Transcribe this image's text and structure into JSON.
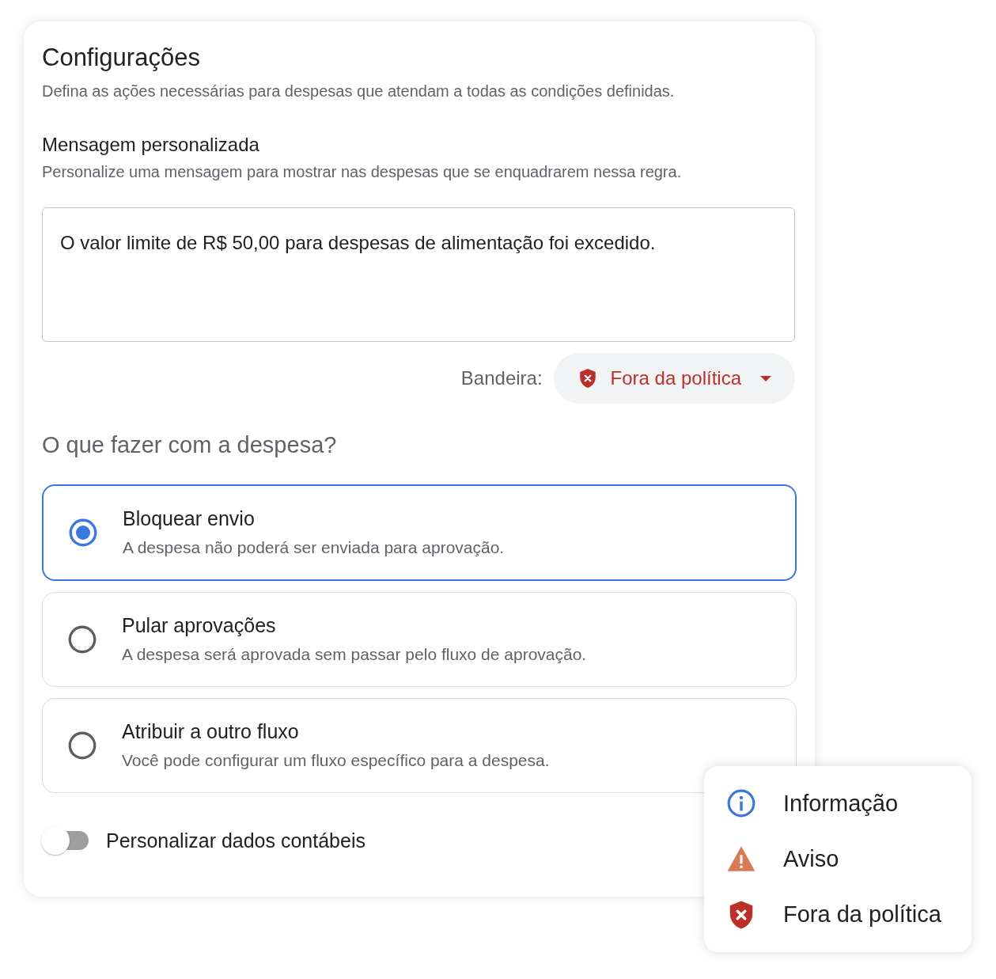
{
  "settings": {
    "title": "Configurações",
    "description": "Defina as ações necessárias para despesas que atendam a todas as condições definidas.",
    "custom_message": {
      "heading": "Mensagem personalizada",
      "description": "Personalize uma mensagem para mostrar nas despesas que se enquadrarem nessa regra.",
      "value": "O valor limite de R$ 50,00 para despesas de alimentação foi excedido."
    },
    "flag": {
      "label": "Bandeira:",
      "value": "Fora da política",
      "kind": "out_of_policy"
    },
    "question": "O que fazer com a despesa?",
    "options": [
      {
        "title": "Bloquear envio",
        "description": "A despesa não poderá ser enviada para aprovação.",
        "selected": true
      },
      {
        "title": "Pular aprovações",
        "description": "A despesa será aprovada sem passar pelo fluxo de aprovação.",
        "selected": false
      },
      {
        "title": "Atribuir a outro fluxo",
        "description": "Você pode configurar um fluxo específico para a despesa.",
        "selected": false
      }
    ],
    "accounting_toggle": {
      "label": "Personalizar dados contábeis",
      "on": false
    }
  },
  "flag_menu": {
    "items": [
      {
        "label": "Informação",
        "kind": "info"
      },
      {
        "label": "Aviso",
        "kind": "warning"
      },
      {
        "label": "Fora da política",
        "kind": "out_of_policy"
      }
    ]
  }
}
